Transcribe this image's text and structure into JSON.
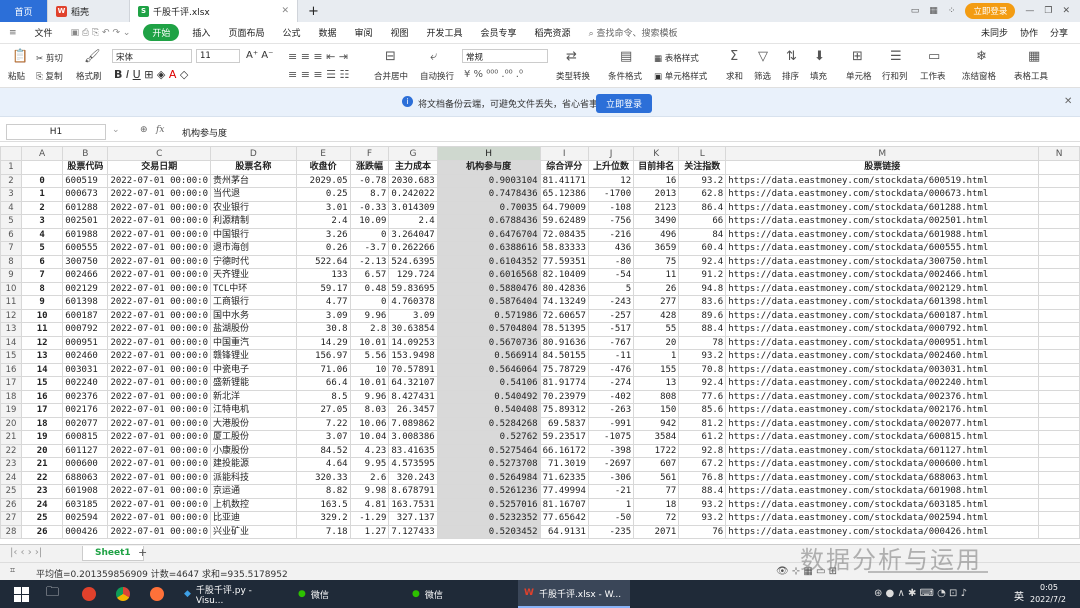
{
  "tabs": {
    "home": "首页",
    "daoke": "稻壳",
    "file": "千股千评.xlsx",
    "new_tab": "+"
  },
  "titlebar_right": {
    "login": "立即登录"
  },
  "menu": [
    "文件",
    "开始",
    "插入",
    "页面布局",
    "公式",
    "数据",
    "审阅",
    "视图",
    "开发工具",
    "会员专享",
    "稻壳资源"
  ],
  "menu_search": "查找命令、搜索模板",
  "menu_right": [
    "未同步",
    "协作",
    "分享"
  ],
  "ribbon": {
    "cut": "剪切",
    "paste": "粘贴",
    "copy": "复制",
    "format_painter": "格式刷",
    "font": "宋体",
    "size": "11",
    "number_format": "常规",
    "merge": "合并居中",
    "wrap": "自动换行",
    "type_convert": "类型转换",
    "cond_format": "条件格式",
    "table_style": "表格样式",
    "cell_style": "单元格样式",
    "sum": "求和",
    "filter": "筛选",
    "sort": "排序",
    "fill": "填充",
    "cell": "单元格",
    "rowcol": "行和列",
    "worksheet": "工作表",
    "freeze": "冻结窗格",
    "table_tools": "表格工具"
  },
  "banner": {
    "text": "将文档备份云端，可避免文件丢失，省心省事",
    "button": "立即登录"
  },
  "formula_bar": {
    "cell": "H1",
    "fx": "fx",
    "value": "机构参与度"
  },
  "col_letters": [
    "A",
    "B",
    "C",
    "D",
    "E",
    "F",
    "G",
    "H",
    "I",
    "J",
    "K",
    "L",
    "M",
    "N"
  ],
  "headers": [
    "",
    "股票代码",
    "交易日期",
    "股票名称",
    "收盘价",
    "涨跌幅",
    "主力成本",
    "机构参与度",
    "综合评分",
    "上升位数",
    "目前排名",
    "关注指数",
    "股票链接"
  ],
  "rows": [
    [
      "0",
      "600519",
      "2022-07-01 00:00:0",
      "贵州茅台",
      "2029.05",
      "-0.78",
      "2030.683",
      "0.9003104",
      "81.41171",
      "12",
      "16",
      "93.2",
      "https://data.eastmoney.com/stockdata/600519.html"
    ],
    [
      "1",
      "000673",
      "2022-07-01 00:00:0",
      "当代退",
      "0.25",
      "8.7",
      "0.242022",
      "0.7478436",
      "65.12386",
      "-1700",
      "2013",
      "62.8",
      "https://data.eastmoney.com/stockdata/000673.html"
    ],
    [
      "2",
      "601288",
      "2022-07-01 00:00:0",
      "农业银行",
      "3.01",
      "-0.33",
      "3.014309",
      "0.70035",
      "64.79009",
      "-108",
      "2123",
      "86.4",
      "https://data.eastmoney.com/stockdata/601288.html"
    ],
    [
      "3",
      "002501",
      "2022-07-01 00:00:0",
      "利源精制",
      "2.4",
      "10.09",
      "2.4",
      "0.6788436",
      "59.62489",
      "-756",
      "3490",
      "66",
      "https://data.eastmoney.com/stockdata/002501.html"
    ],
    [
      "4",
      "601988",
      "2022-07-01 00:00:0",
      "中国银行",
      "3.26",
      "0",
      "3.264047",
      "0.6476704",
      "72.08435",
      "-216",
      "496",
      "84",
      "https://data.eastmoney.com/stockdata/601988.html"
    ],
    [
      "5",
      "600555",
      "2022-07-01 00:00:0",
      "退市海创",
      "0.26",
      "-3.7",
      "0.262266",
      "0.6388616",
      "58.83333",
      "436",
      "3659",
      "60.4",
      "https://data.eastmoney.com/stockdata/600555.html"
    ],
    [
      "6",
      "300750",
      "2022-07-01 00:00:0",
      "宁德时代",
      "522.64",
      "-2.13",
      "524.6395",
      "0.6104352",
      "77.59351",
      "-80",
      "75",
      "92.4",
      "https://data.eastmoney.com/stockdata/300750.html"
    ],
    [
      "7",
      "002466",
      "2022-07-01 00:00:0",
      "天齐锂业",
      "133",
      "6.57",
      "129.724",
      "0.6016568",
      "82.10409",
      "-54",
      "11",
      "91.2",
      "https://data.eastmoney.com/stockdata/002466.html"
    ],
    [
      "8",
      "002129",
      "2022-07-01 00:00:0",
      "TCL中环",
      "59.17",
      "0.48",
      "59.83695",
      "0.5880476",
      "80.42836",
      "5",
      "26",
      "94.8",
      "https://data.eastmoney.com/stockdata/002129.html"
    ],
    [
      "9",
      "601398",
      "2022-07-01 00:00:0",
      "工商银行",
      "4.77",
      "0",
      "4.760378",
      "0.5876404",
      "74.13249",
      "-243",
      "277",
      "83.6",
      "https://data.eastmoney.com/stockdata/601398.html"
    ],
    [
      "10",
      "600187",
      "2022-07-01 00:00:0",
      "国中水务",
      "3.09",
      "9.96",
      "3.09",
      "0.571986",
      "72.60657",
      "-257",
      "428",
      "89.6",
      "https://data.eastmoney.com/stockdata/600187.html"
    ],
    [
      "11",
      "000792",
      "2022-07-01 00:00:0",
      "盐湖股份",
      "30.8",
      "2.8",
      "30.63854",
      "0.5704804",
      "78.51395",
      "-517",
      "55",
      "88.4",
      "https://data.eastmoney.com/stockdata/000792.html"
    ],
    [
      "12",
      "000951",
      "2022-07-01 00:00:0",
      "中国重汽",
      "14.29",
      "10.01",
      "14.09253",
      "0.5670736",
      "80.91636",
      "-767",
      "20",
      "78",
      "https://data.eastmoney.com/stockdata/000951.html"
    ],
    [
      "13",
      "002460",
      "2022-07-01 00:00:0",
      "赣锋锂业",
      "156.97",
      "5.56",
      "153.9498",
      "0.566914",
      "84.50155",
      "-11",
      "1",
      "93.2",
      "https://data.eastmoney.com/stockdata/002460.html"
    ],
    [
      "14",
      "003031",
      "2022-07-01 00:00:0",
      "中瓷电子",
      "71.06",
      "10",
      "70.57891",
      "0.5646064",
      "75.78729",
      "-476",
      "155",
      "70.8",
      "https://data.eastmoney.com/stockdata/003031.html"
    ],
    [
      "15",
      "002240",
      "2022-07-01 00:00:0",
      "盛新锂能",
      "66.4",
      "10.01",
      "64.32107",
      "0.54106",
      "81.91774",
      "-274",
      "13",
      "92.4",
      "https://data.eastmoney.com/stockdata/002240.html"
    ],
    [
      "16",
      "002376",
      "2022-07-01 00:00:0",
      "新北洋",
      "8.5",
      "9.96",
      "8.427431",
      "0.540492",
      "70.23979",
      "-402",
      "808",
      "77.6",
      "https://data.eastmoney.com/stockdata/002376.html"
    ],
    [
      "17",
      "002176",
      "2022-07-01 00:00:0",
      "江特电机",
      "27.05",
      "8.03",
      "26.3457",
      "0.540408",
      "75.89312",
      "-263",
      "150",
      "85.6",
      "https://data.eastmoney.com/stockdata/002176.html"
    ],
    [
      "18",
      "002077",
      "2022-07-01 00:00:0",
      "大港股份",
      "7.22",
      "10.06",
      "7.089862",
      "0.5284268",
      "69.5837",
      "-991",
      "942",
      "81.2",
      "https://data.eastmoney.com/stockdata/002077.html"
    ],
    [
      "19",
      "600815",
      "2022-07-01 00:00:0",
      "厦工股份",
      "3.07",
      "10.04",
      "3.008386",
      "0.52762",
      "59.23517",
      "-1075",
      "3584",
      "61.2",
      "https://data.eastmoney.com/stockdata/600815.html"
    ],
    [
      "20",
      "601127",
      "2022-07-01 00:00:0",
      "小康股份",
      "84.52",
      "4.23",
      "83.41635",
      "0.5275464",
      "66.16172",
      "-398",
      "1722",
      "92.8",
      "https://data.eastmoney.com/stockdata/601127.html"
    ],
    [
      "21",
      "000600",
      "2022-07-01 00:00:0",
      "建投能源",
      "4.64",
      "9.95",
      "4.573595",
      "0.5273708",
      "71.3019",
      "-2697",
      "607",
      "67.2",
      "https://data.eastmoney.com/stockdata/000600.html"
    ],
    [
      "22",
      "688063",
      "2022-07-01 00:00:0",
      "派能科技",
      "320.33",
      "2.6",
      "320.243",
      "0.5264984",
      "71.62335",
      "-306",
      "561",
      "76.8",
      "https://data.eastmoney.com/stockdata/688063.html"
    ],
    [
      "23",
      "601908",
      "2022-07-01 00:00:0",
      "京运通",
      "8.82",
      "9.98",
      "8.678791",
      "0.5261236",
      "77.49994",
      "-21",
      "77",
      "88.4",
      "https://data.eastmoney.com/stockdata/601908.html"
    ],
    [
      "24",
      "603185",
      "2022-07-01 00:00:0",
      "上机数控",
      "163.5",
      "4.81",
      "163.7531",
      "0.5257016",
      "81.16707",
      "1",
      "18",
      "93.2",
      "https://data.eastmoney.com/stockdata/603185.html"
    ],
    [
      "25",
      "002594",
      "2022-07-01 00:00:0",
      "比亚迪",
      "329.2",
      "-1.29",
      "327.137",
      "0.5232352",
      "77.65642",
      "-50",
      "72",
      "93.2",
      "https://data.eastmoney.com/stockdata/002594.html"
    ],
    [
      "26",
      "000426",
      "2022-07-01 00:00:0",
      "兴业矿业",
      "7.18",
      "1.27",
      "7.127433",
      "0.5203452",
      "64.9131",
      "-235",
      "2071",
      "76",
      "https://data.eastmoney.com/stockdata/000426.html"
    ]
  ],
  "sheet": {
    "name": "Sheet1",
    "add": "+"
  },
  "status": {
    "text": "平均值=0.201359856909  计数=4647  求和=935.5178952"
  },
  "watermark": "数据分析与运用",
  "taskbar": {
    "items": [
      "千股千评.py - Visu...",
      "微信",
      "微信",
      "千股千评.xlsx - W..."
    ],
    "lang": "英",
    "time": "0:05",
    "date": "2022/7/2"
  }
}
